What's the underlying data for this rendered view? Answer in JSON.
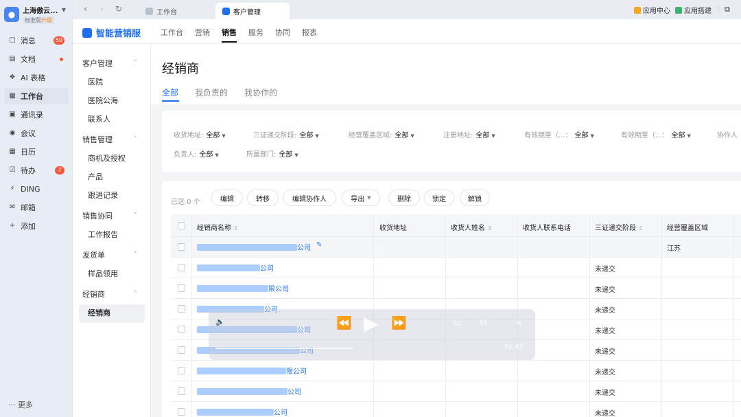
{
  "org": {
    "name": "上海傲云...",
    "tier": "标准版",
    "upgrade": "升级"
  },
  "rail": [
    {
      "label": "消息",
      "icon": "message-icon",
      "badge": "50"
    },
    {
      "label": "文档",
      "icon": "doc-icon",
      "dot": true
    },
    {
      "label": "AI 表格",
      "icon": "ai-table-icon"
    },
    {
      "label": "工作台",
      "icon": "workbench-icon",
      "active": true
    },
    {
      "label": "通讯录",
      "icon": "contacts-icon"
    },
    {
      "label": "会议",
      "icon": "meeting-icon"
    },
    {
      "label": "日历",
      "icon": "calendar-icon"
    },
    {
      "label": "待办",
      "icon": "todo-icon",
      "badge": "7"
    },
    {
      "label": "DING",
      "icon": "ding-icon"
    },
    {
      "label": "邮箱",
      "icon": "mail-icon"
    },
    {
      "label": "添加",
      "icon": "plus-icon"
    }
  ],
  "rail_more": "··· 更多",
  "tabs": [
    {
      "label": "工作台",
      "active": false
    },
    {
      "label": "客户管理",
      "active": true
    }
  ],
  "top_right": {
    "app_center": "应用中心",
    "app_builder": "应用搭建"
  },
  "app": {
    "brand": "智能营销服",
    "nav": [
      "工作台",
      "营销",
      "销售",
      "服务",
      "协同",
      "报表"
    ],
    "nav_active": "销售"
  },
  "sidenav": [
    {
      "group": "客户管理",
      "items": [
        "医院",
        "医院公海",
        "联系人"
      ]
    },
    {
      "group": "销售管理",
      "items": [
        "商机及授权",
        "产品",
        "跟进记录"
      ]
    },
    {
      "group": "销售协同",
      "items": [
        "工作报告"
      ]
    },
    {
      "group": "发货单",
      "items": [
        "样品领用"
      ]
    },
    {
      "group": "经销商",
      "items": [
        "经销商"
      ]
    }
  ],
  "page": {
    "title": "经销商",
    "subtabs": [
      "全部",
      "我负责的",
      "我协作的"
    ],
    "active_subtab": "全部"
  },
  "filters": [
    {
      "label": "收货地址:",
      "value": "全部"
    },
    {
      "label": "三证递交阶段:",
      "value": "全部"
    },
    {
      "label": "经营覆盖区域:",
      "value": "全部"
    },
    {
      "label": "注册地址:",
      "value": "全部"
    },
    {
      "label": "有效期至（...：",
      "value": "全部"
    },
    {
      "label": "有效期至（...：",
      "value": "全部"
    },
    {
      "label": "协作人",
      "value": ""
    },
    {
      "label": "负责人:",
      "value": "全部"
    },
    {
      "label": "所属部门:",
      "value": "全部"
    }
  ],
  "toolbar": {
    "selected": "已选 0 个",
    "buttons": [
      "编辑",
      "转移",
      "编辑协作人",
      "导出",
      "删除",
      "锁定",
      "解锁"
    ]
  },
  "table": {
    "columns": [
      "经销商名称",
      "收货地址",
      "收货人姓名",
      "收货人联系电话",
      "三证递交阶段",
      "经营覆盖区域"
    ],
    "rows": [
      {
        "name_suffix": "公司",
        "stage": "",
        "region": "江苏"
      },
      {
        "name_suffix": "公司",
        "stage": "未递交",
        "region": ""
      },
      {
        "name_suffix": "限公司",
        "stage": "未递交",
        "region": ""
      },
      {
        "name_suffix": "公司",
        "stage": "未递交",
        "region": ""
      },
      {
        "name_suffix": "公司",
        "stage": "未递交",
        "region": ""
      },
      {
        "name_suffix": "公司",
        "stage": "未递交",
        "region": ""
      },
      {
        "name_suffix": "限公司",
        "stage": "未递交",
        "region": ""
      },
      {
        "name_suffix": "公司",
        "stage": "未递交",
        "region": ""
      },
      {
        "name_suffix": "公司",
        "stage": "未递交",
        "region": ""
      }
    ]
  },
  "video": {
    "time": "30:42"
  },
  "colors": {
    "accent": "#1f6ff2",
    "rail_bg": "#e8ecf4",
    "badge": "#f25c3c"
  }
}
